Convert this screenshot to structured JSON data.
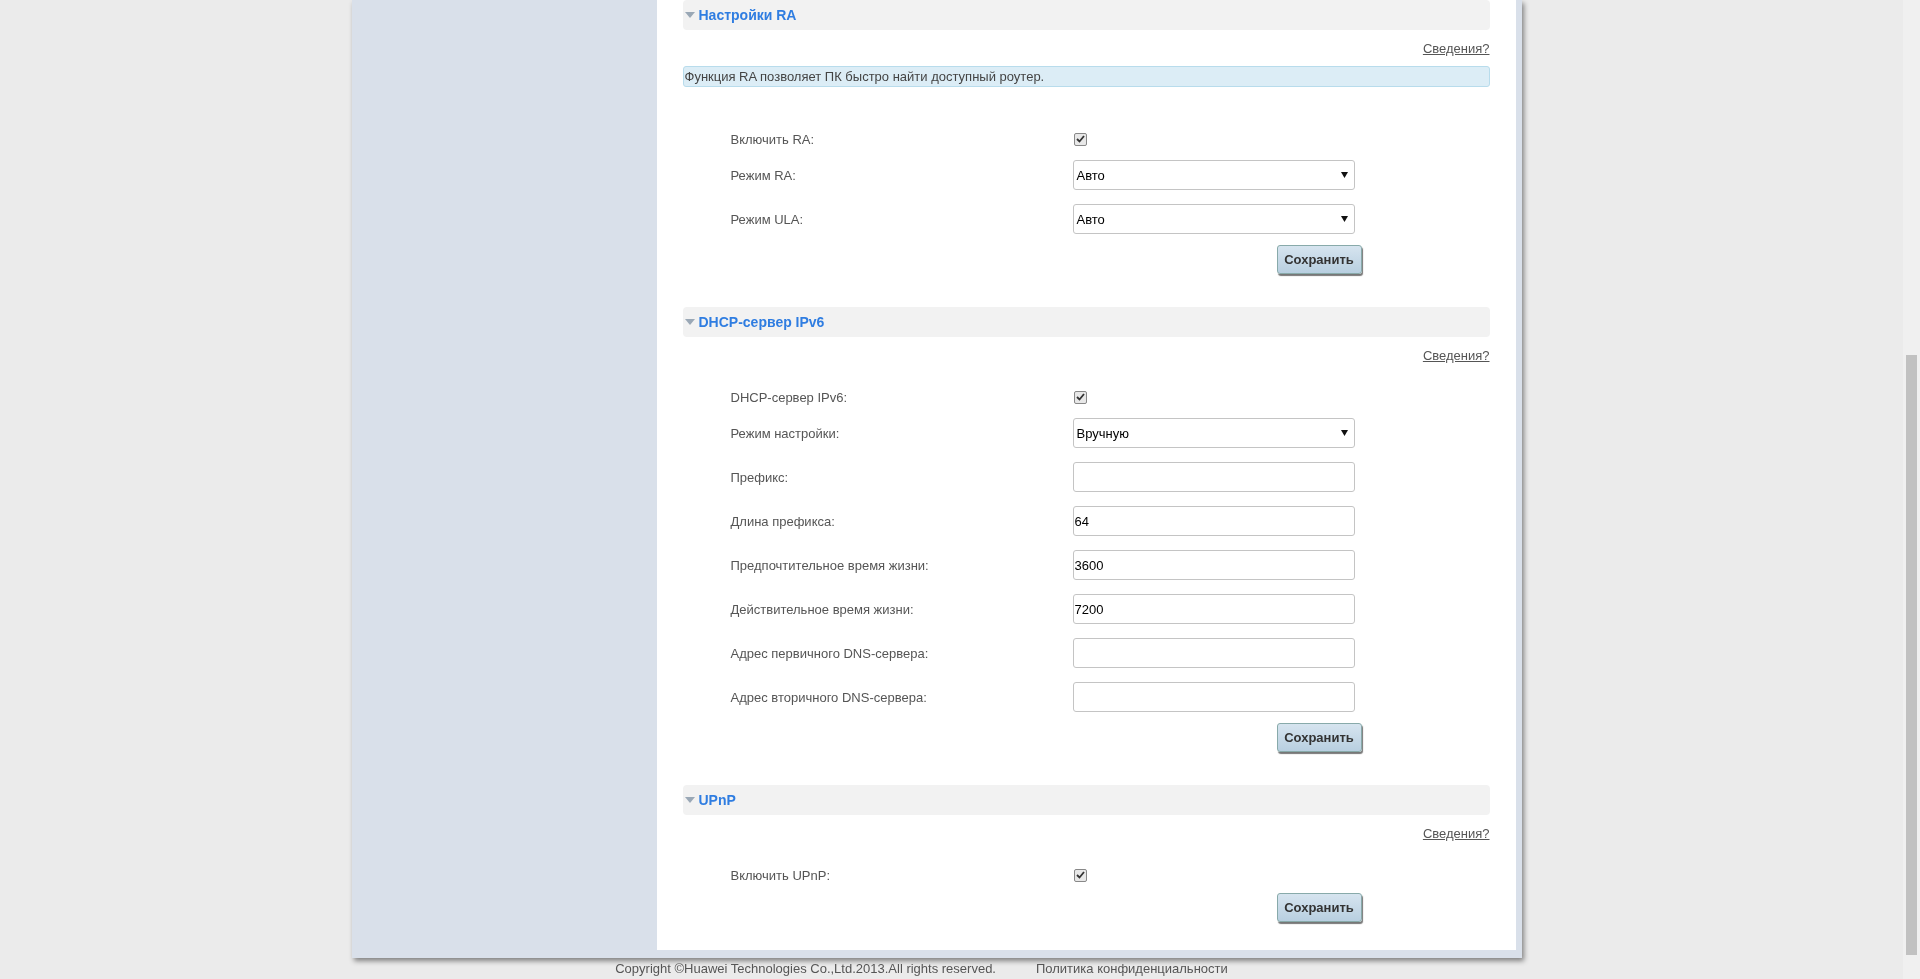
{
  "sections": [
    {
      "title": "Настройки RA",
      "expanded": true,
      "info_link": "Сведения?",
      "note": "Функция RA позволяет ПК быстро найти доступный роутер.",
      "fields": [
        {
          "kind": "checkbox",
          "label": "Включить RA:",
          "checked": true
        },
        {
          "kind": "select",
          "label": "Режим RA:",
          "value": "Авто"
        },
        {
          "kind": "select",
          "label": "Режим ULA:",
          "value": "Авто"
        }
      ],
      "save_button": "Сохранить"
    },
    {
      "title": "DHCP-сервер IPv6",
      "expanded": true,
      "info_link": "Сведения?",
      "fields": [
        {
          "kind": "checkbox",
          "label": "DHCP-сервер IPv6:",
          "checked": true
        },
        {
          "kind": "select",
          "label": "Режим настройки:",
          "value": "Вручную"
        },
        {
          "kind": "text",
          "label": "Префикс:"
        },
        {
          "kind": "text",
          "label": "Длина префикса:",
          "value": "64"
        },
        {
          "kind": "text",
          "label": "Предпочтительное время жизни:",
          "value": "3600"
        },
        {
          "kind": "text",
          "label": "Действительное время жизни:",
          "value": "7200"
        },
        {
          "kind": "text",
          "label": "Адрес первичного DNS-сервера:"
        },
        {
          "kind": "text",
          "label": "Адрес вторичного DNS-сервера:"
        }
      ],
      "save_button": "Сохранить"
    },
    {
      "title": "UPnP",
      "expanded": true,
      "info_link": "Сведения?",
      "fields": [
        {
          "kind": "checkbox",
          "label": "Включить UPnP:",
          "checked": true
        }
      ],
      "save_button": "Сохранить"
    }
  ],
  "footer": {
    "copyright": "Copyright ©Huawei Technologies Co.,Ltd.2013.All rights reserved.",
    "privacy_link": "Политика конфиденциальности"
  }
}
